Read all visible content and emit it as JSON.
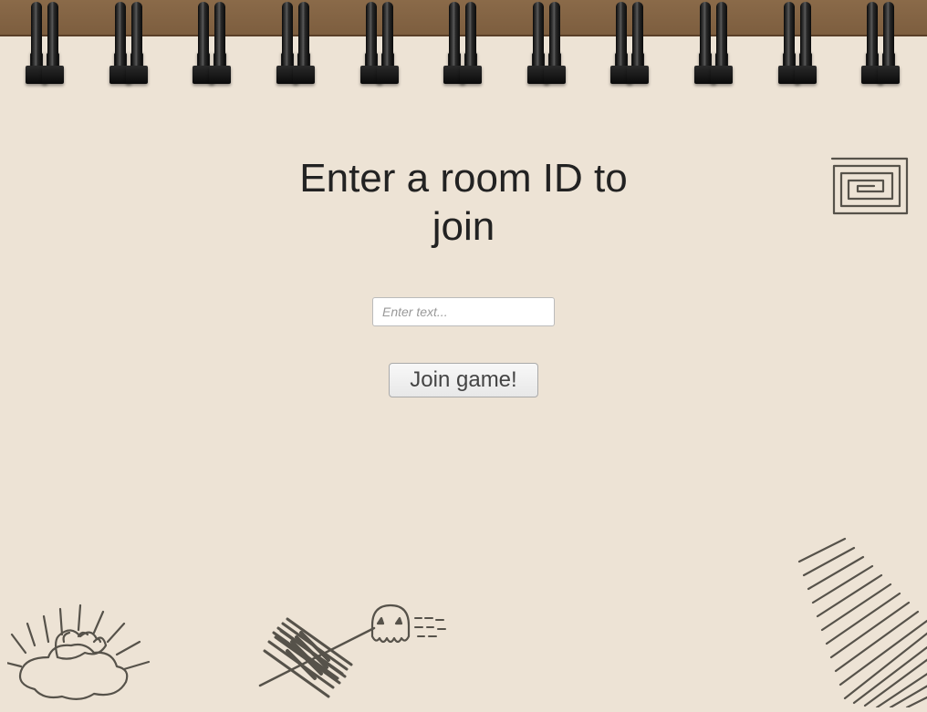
{
  "form": {
    "heading": "Enter a room ID to join",
    "room_input_placeholder": "Enter text...",
    "join_button_label": "Join game!"
  }
}
